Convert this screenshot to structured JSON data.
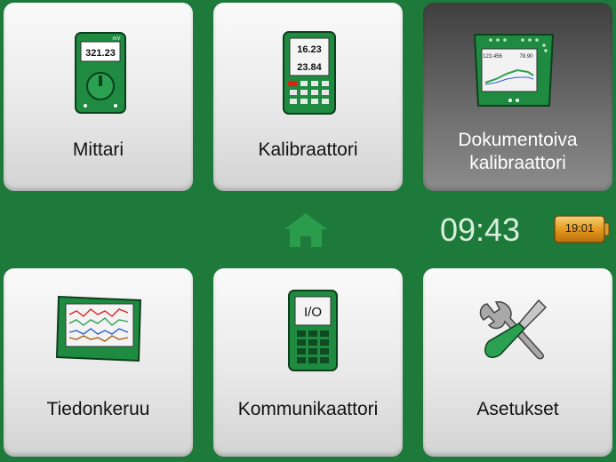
{
  "tiles": {
    "mittari": {
      "label": "Mittari",
      "display_value": "321.23",
      "unit": "mV"
    },
    "kalibraattori": {
      "label": "Kalibraattori",
      "display_top": "16.23",
      "display_bottom": "23.84"
    },
    "dokumentoiva": {
      "label_line1": "Dokumentoiva",
      "label_line2": "kalibraattori",
      "display_left": "123.456",
      "display_right": "78.90"
    },
    "tiedonkeruu": {
      "label": "Tiedonkeruu"
    },
    "kommunikaattori": {
      "label": "Kommunikaattori",
      "screen_text": "I/O"
    },
    "asetukset": {
      "label": "Asetukset"
    }
  },
  "status_bar": {
    "time": "09:43",
    "battery_time": "19:01"
  },
  "colors": {
    "brand_green": "#1e7a3b",
    "clock_text": "#d9efdc",
    "battery_fill": "#e59a1e"
  },
  "icons": {
    "home": "home-icon",
    "wrench": "wrench-icon",
    "screwdriver": "screwdriver-icon"
  }
}
